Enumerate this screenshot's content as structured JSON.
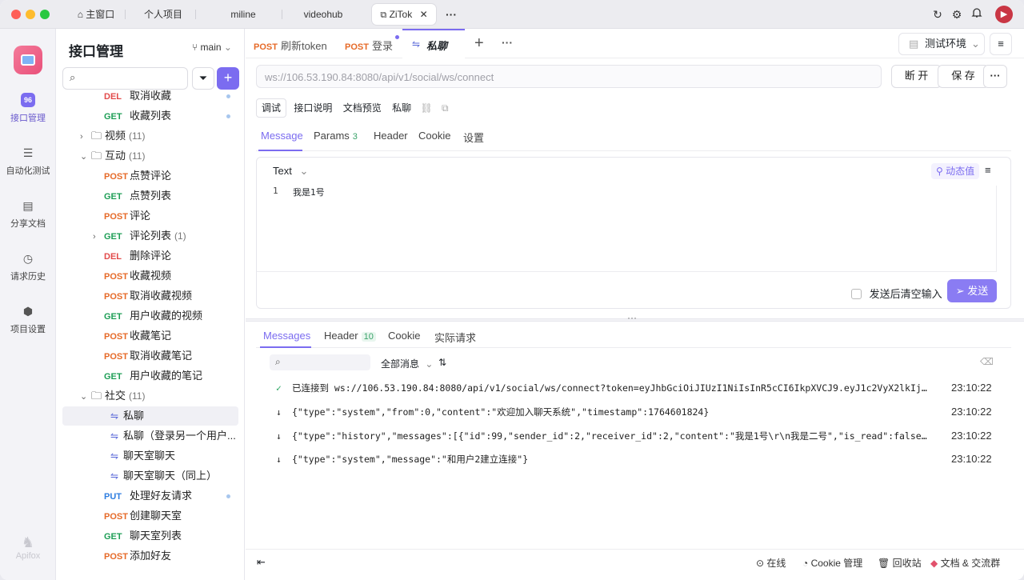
{
  "window_tabs": [
    {
      "label": "主窗口"
    },
    {
      "label": "个人项目"
    },
    {
      "label": "miline"
    },
    {
      "label": "videohub"
    },
    {
      "label": "ZiTok"
    }
  ],
  "more_tabs": "···",
  "leftnav": {
    "logo_text": "Apifox",
    "items": [
      {
        "label": "接口管理",
        "icon": "api-icon",
        "badge": "96"
      },
      {
        "label": "自动化测试",
        "icon": "automation-icon"
      },
      {
        "label": "分享文档",
        "icon": "book-icon"
      },
      {
        "label": "请求历史",
        "icon": "clock-icon"
      },
      {
        "label": "项目设置",
        "icon": "settings-icon"
      }
    ]
  },
  "sidebar": {
    "title": "接口管理",
    "branch": "main",
    "search_placeholder": "",
    "tree": [
      {
        "method": "DEL",
        "name": "取消收藏",
        "dot": true
      },
      {
        "method": "GET",
        "name": "收藏列表",
        "dot": true
      },
      {
        "folder": "视频",
        "count": "(11)",
        "expanded": false
      },
      {
        "folder": "互动",
        "count": "(11)",
        "expanded": true
      },
      {
        "method": "POST",
        "name": "点赞评论"
      },
      {
        "method": "GET",
        "name": "点赞列表"
      },
      {
        "method": "POST",
        "name": "评论"
      },
      {
        "method": "GET",
        "name": "评论列表",
        "count": "(1)",
        "expandable": true
      },
      {
        "method": "DEL",
        "name": "删除评论"
      },
      {
        "method": "POST",
        "name": "收藏视频"
      },
      {
        "method": "POST",
        "name": "取消收藏视频"
      },
      {
        "method": "GET",
        "name": "用户收藏的视频"
      },
      {
        "method": "POST",
        "name": "收藏笔记"
      },
      {
        "method": "POST",
        "name": "取消收藏笔记"
      },
      {
        "method": "GET",
        "name": "用户收藏的笔记"
      },
      {
        "folder": "社交",
        "count": "(11)",
        "expanded": true
      },
      {
        "ws": true,
        "name": "私聊",
        "selected": true
      },
      {
        "ws": true,
        "name": "私聊（登录另一个用户..."
      },
      {
        "ws": true,
        "name": "聊天室聊天"
      },
      {
        "ws": true,
        "name": "聊天室聊天（同上）"
      },
      {
        "method": "PUT",
        "name": "处理好友请求",
        "dot": true
      },
      {
        "method": "POST",
        "name": "创建聊天室"
      },
      {
        "method": "GET",
        "name": "聊天室列表"
      },
      {
        "method": "POST",
        "name": "添加好友"
      }
    ]
  },
  "tabs": [
    {
      "method": "POST",
      "label": "刷新token"
    },
    {
      "method": "POST",
      "label": "登录",
      "modified": true
    },
    {
      "ws": true,
      "label": "私聊",
      "active": true
    }
  ],
  "env": {
    "label": "测试环境"
  },
  "url": {
    "value": "ws://106.53.190.84:8080/api/v1/social/ws/connect"
  },
  "buttons": {
    "disconnect": "断 开",
    "save": "保 存",
    "send": "发送",
    "clear_after_send": "发送后清空输入",
    "dynamic_value": "动态值"
  },
  "mode_tabs": [
    "调试",
    "接口说明",
    "文档预览"
  ],
  "api_name": "私聊",
  "request_tabs": [
    {
      "label": "Message",
      "active": true
    },
    {
      "label": "Params",
      "count": "3"
    },
    {
      "label": "Header"
    },
    {
      "label": "Cookie"
    },
    {
      "label": "设置"
    }
  ],
  "editor": {
    "format": "Text",
    "line_no": "1",
    "content": "我是1号"
  },
  "response_tabs": [
    {
      "label": "Messages",
      "active": true
    },
    {
      "label": "Header",
      "count": "10"
    },
    {
      "label": "Cookie"
    },
    {
      "label": "实际请求"
    }
  ],
  "filter": {
    "label": "全部消息"
  },
  "messages": [
    {
      "kind": "connected",
      "text": "已连接到 ws://106.53.190.84:8080/api/v1/social/ws/connect?token=eyJhbGciOiJIUzI1NiIsInR5cCI6IkpXVCJ9.eyJ1c2VyX2lkIjoyLCJleHAiOjE…",
      "time": "23:10:22"
    },
    {
      "kind": "recv",
      "text": "{\"type\":\"system\",\"from\":0,\"content\":\"欢迎加入聊天系统\",\"timestamp\":1764601824}",
      "time": "23:10:22"
    },
    {
      "kind": "recv",
      "text": "{\"type\":\"history\",\"messages\":[{\"id\":99,\"sender_id\":2,\"receiver_id\":2,\"content\":\"我是1号\\r\\n我是二号\",\"is_read\":false,\"created_at\"…",
      "time": "23:10:22"
    },
    {
      "kind": "recv",
      "text": "{\"type\":\"system\",\"message\":\"和用户2建立连接\"}",
      "time": "23:10:22"
    }
  ],
  "footer": {
    "online": "在线",
    "cookie": "Cookie 管理",
    "recycle": "回收站",
    "docs": "文档 & 交流群"
  }
}
